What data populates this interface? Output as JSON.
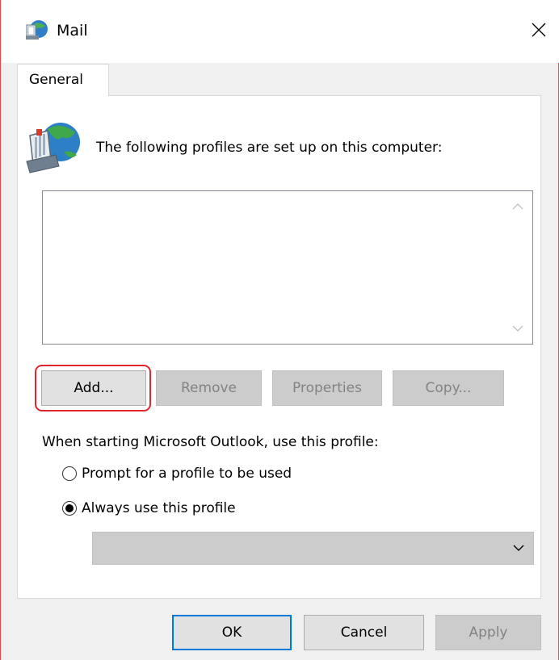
{
  "window": {
    "title": "Mail",
    "title_icon": "mail-globe-icon",
    "close_icon": "close-icon"
  },
  "tabs": [
    {
      "label": "General",
      "selected": true
    }
  ],
  "general": {
    "profiles_label": "The following profiles are set up on this computer:",
    "profiles": [],
    "buttons": {
      "add": {
        "label": "Add...",
        "enabled": true
      },
      "remove": {
        "label": "Remove",
        "enabled": false
      },
      "properties": {
        "label": "Properties",
        "enabled": false
      },
      "copy": {
        "label": "Copy...",
        "enabled": false
      }
    },
    "startup_label": "When starting Microsoft Outlook, use this profile:",
    "options": [
      {
        "label": "Prompt for a profile to be used",
        "selected": false
      },
      {
        "label": "Always use this profile",
        "selected": true
      }
    ],
    "profile_select": {
      "value": "",
      "enabled": false
    }
  },
  "footer": {
    "ok": "OK",
    "cancel": "Cancel",
    "apply": "Apply"
  },
  "colors": {
    "highlight": "#e0262b",
    "default_button_border": "#0078d7"
  }
}
